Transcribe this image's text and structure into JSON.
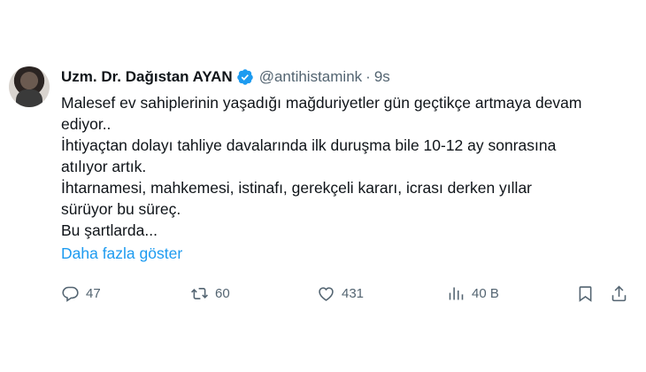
{
  "author": {
    "name": "Uzm. Dr. Dağıstan AYAN",
    "handle": "@antihistamink",
    "separator": "·",
    "time": "9s",
    "verified": true
  },
  "tweet": {
    "lines": [
      "Malesef ev sahiplerinin yaşadığı mağduriyetler gün geçtikçe artmaya devam",
      "ediyor..",
      "İhtiyaçtan dolayı tahliye davalarında ilk duruşma bile 10-12 ay sonrasına",
      "atılıyor artık.",
      "İhtarnamesi, mahkemesi, istinafı, gerekçeli kararı, icrası derken yıllar",
      "sürüyor bu süreç.",
      "Bu şartlarda..."
    ],
    "show_more": "Daha fazla göster"
  },
  "actions": {
    "replies": "47",
    "retweets": "60",
    "likes": "431",
    "views": "40 B"
  },
  "colors": {
    "text": "#0f1419",
    "muted": "#536471",
    "link": "#1d9bf0",
    "verified": "#1d9bf0"
  },
  "icons": [
    "reply-icon",
    "retweet-icon",
    "like-icon",
    "views-icon",
    "bookmark-icon",
    "share-icon",
    "verified-badge-icon"
  ]
}
